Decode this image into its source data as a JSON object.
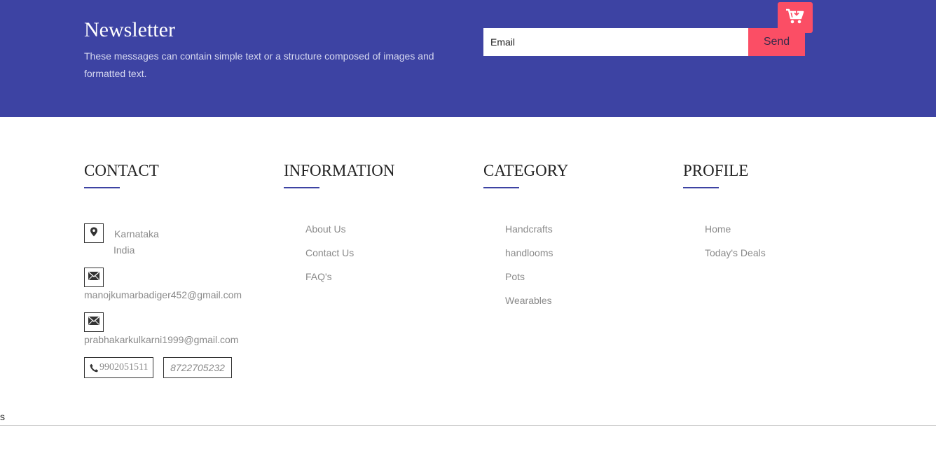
{
  "newsletter": {
    "title": "Newsletter",
    "description": "These messages can contain simple text or a structure composed of images and formatted text.",
    "email_placeholder": "Email",
    "send_label": "Send"
  },
  "cart": {
    "icon": "cart-icon"
  },
  "contact": {
    "title": "CONTACT",
    "location_line1": "Karnataka",
    "location_line2": "India",
    "email1": "manojkumarbadiger452@gmail.com",
    "email2": "prabhakarkulkarni1999@gmail.com",
    "phone1": "9902051511",
    "phone2": "8722705232"
  },
  "information": {
    "title": "INFORMATION",
    "links": [
      "About Us",
      "Contact Us",
      "FAQ's"
    ]
  },
  "category": {
    "title": "CATEGORY",
    "links": [
      "Handcrafts",
      "handlooms",
      "Pots",
      "Wearables"
    ]
  },
  "profile": {
    "title": "PROFILE",
    "links": [
      "Home",
      "Today's Deals"
    ]
  },
  "stray_text": "s",
  "colors": {
    "banner": "#3d43a3",
    "accent": "#fb4e65",
    "underline": "#3d43a3",
    "muted_text": "#8a8a8a"
  }
}
